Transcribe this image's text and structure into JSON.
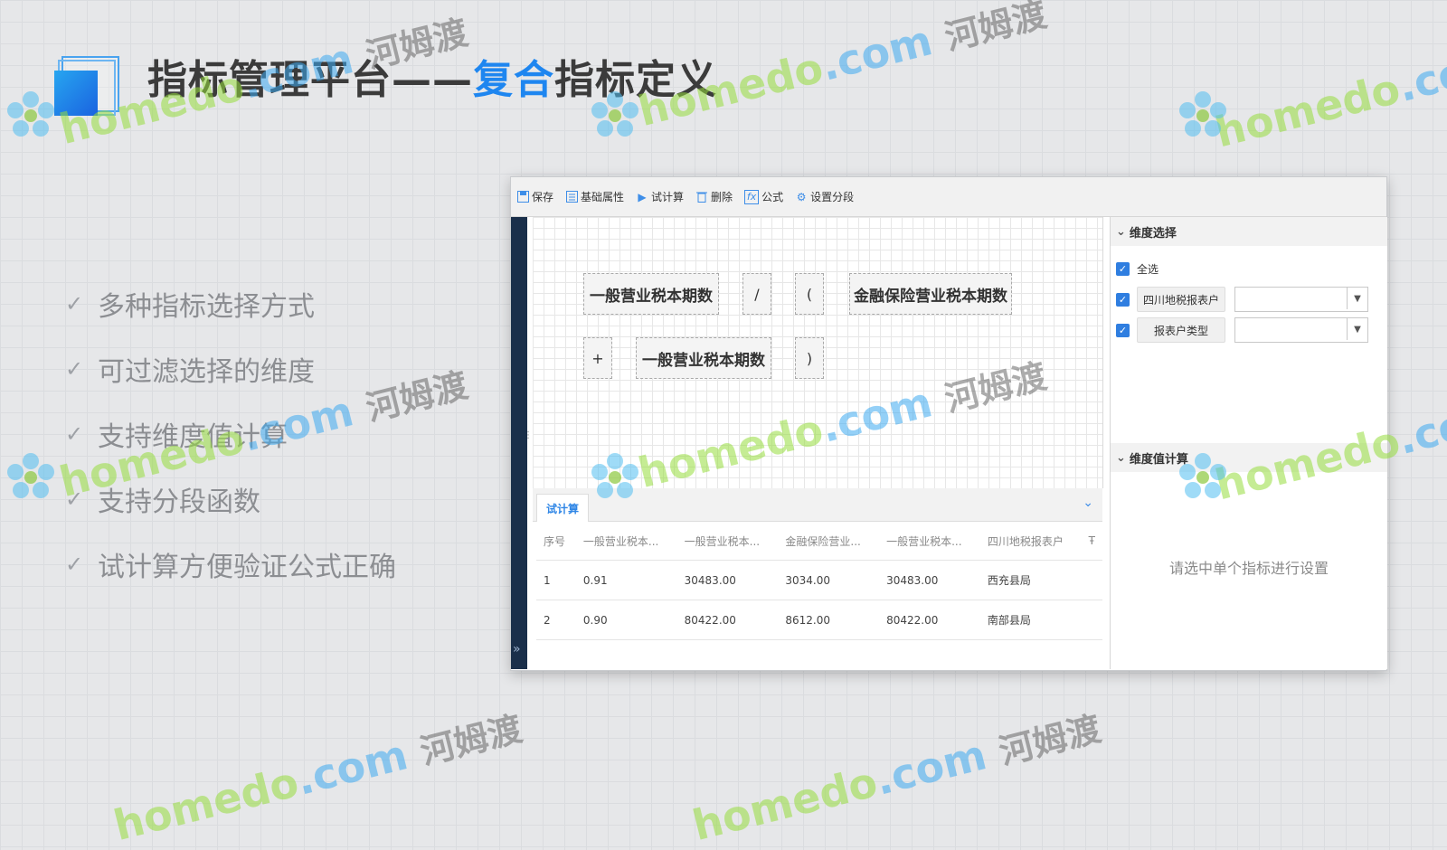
{
  "title": {
    "prefix": "指标管理平台——",
    "highlight": "复合",
    "suffix": "指标定义"
  },
  "features": [
    "多种指标选择方式",
    "可过滤选择的维度",
    "支持维度值计算",
    "支持分段函数",
    "试计算方便验证公式正确"
  ],
  "toolbar": [
    {
      "label": "保存",
      "icon": "save-icon"
    },
    {
      "label": "基础属性",
      "icon": "list-icon"
    },
    {
      "label": "试计算",
      "icon": "play-icon"
    },
    {
      "label": "删除",
      "icon": "trash-icon"
    },
    {
      "label": "公式",
      "icon": "formula-icon"
    },
    {
      "label": "设置分段",
      "icon": "gear-icon"
    }
  ],
  "formula": {
    "row1": [
      "一般营业税本期数",
      "/",
      "(",
      "金融保险营业税本期数"
    ],
    "row2": [
      "+",
      "一般营业税本期数",
      ")"
    ]
  },
  "bottom": {
    "tab": "试计算",
    "columns": [
      "序号",
      "一般营业税本...",
      "一般营业税本...",
      "金融保险营业...",
      "一般营业税本...",
      "四川地税报表户",
      "Ŧ"
    ],
    "rows": [
      [
        "1",
        "0.91",
        "30483.00",
        "3034.00",
        "30483.00",
        "西充县局"
      ],
      [
        "2",
        "0.90",
        "80422.00",
        "8612.00",
        "80422.00",
        "南部县局"
      ]
    ]
  },
  "right": {
    "dim_header": "维度选择",
    "select_all": "全选",
    "dims": [
      {
        "label": "四川地税报表户",
        "value": ""
      },
      {
        "label": "报表户类型",
        "value": ""
      }
    ],
    "calc_header": "维度值计算",
    "placeholder": "请选中单个指标进行设置"
  },
  "watermark": {
    "brand": "homedo",
    "domain": ".com",
    "cn": "河姆渡"
  },
  "colors": {
    "accent": "#1e86f0",
    "navbar": "#1a2f4a",
    "checkbox": "#2f7ee0"
  }
}
